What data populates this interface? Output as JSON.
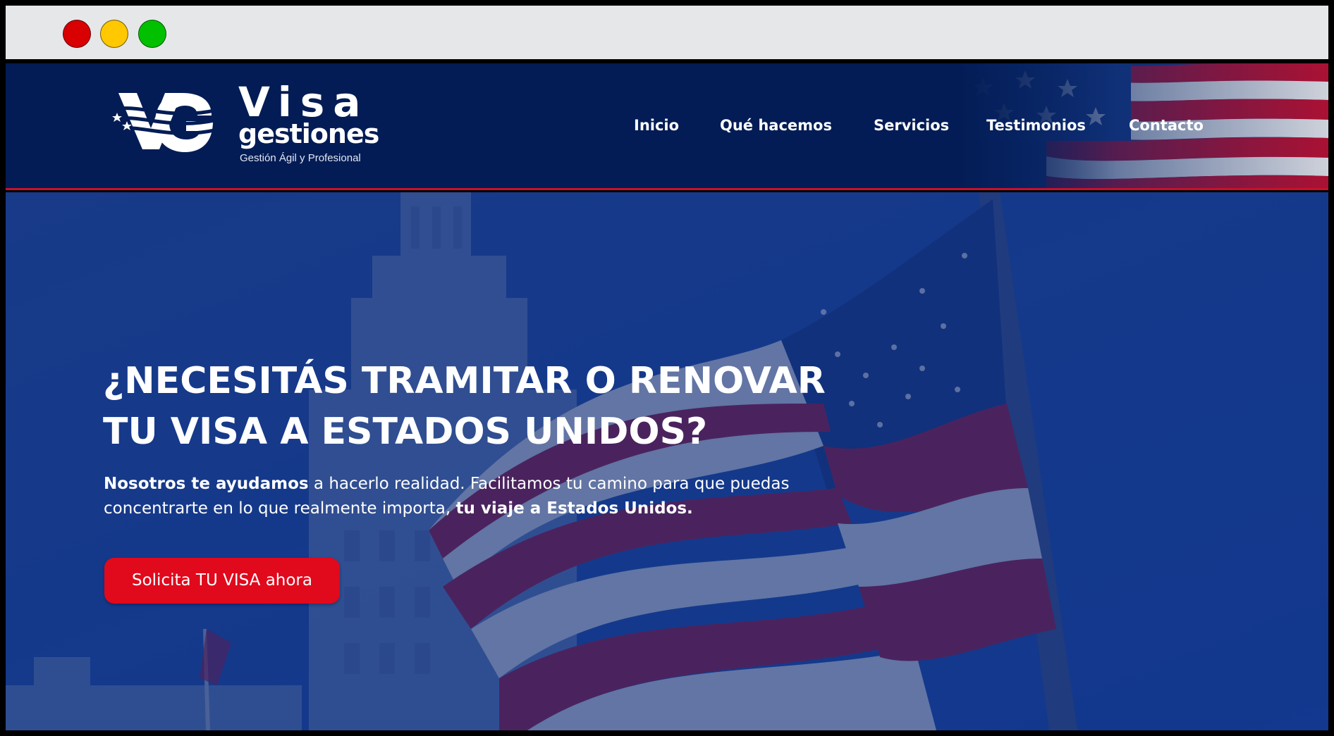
{
  "window": {
    "controls": [
      "close",
      "minimize",
      "maximize"
    ],
    "colors": {
      "close": "#d80000",
      "minimize": "#ffc800",
      "maximize": "#00c000"
    }
  },
  "header": {
    "logo": {
      "monogram": "VG",
      "word_top": "Visa",
      "word_bottom": "gestiones",
      "tagline": "Gestión Ágil y Profesional"
    },
    "nav": [
      {
        "label": "Inicio"
      },
      {
        "label": "Qué hacemos"
      },
      {
        "label": "Servicios"
      },
      {
        "label": "Testimonios"
      },
      {
        "label": "Contacto"
      }
    ],
    "accent": "#c8102e",
    "background": "#031c55"
  },
  "hero": {
    "title_line1": "¿NECESITÁS TRAMITAR O RENOVAR",
    "title_line2": "TU VISA A ESTADOS UNIDOS?",
    "desc_bold_1": "Nosotros te ayudamos",
    "desc_text_1": " a hacerlo realidad. Facilitamos tu camino para que puedas concentrarte en lo que realmente importa, ",
    "desc_bold_2": "tu viaje a Estados Unidos.",
    "cta_label": "Solicita TU VISA ahora",
    "cta_color": "#e1091c"
  }
}
